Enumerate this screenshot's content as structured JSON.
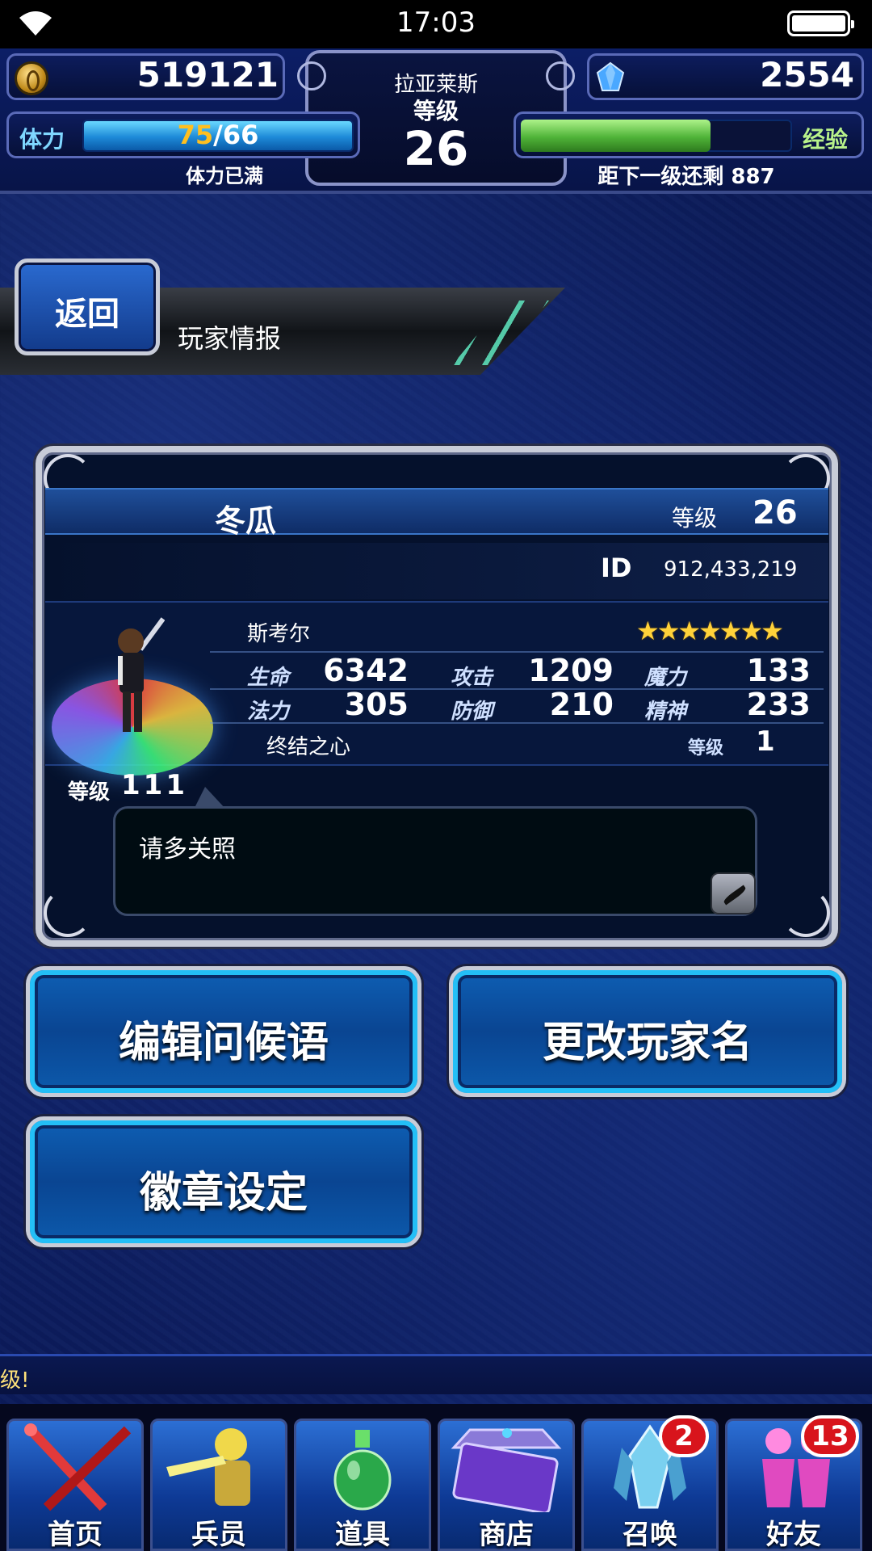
{
  "status_bar": {
    "time": "17:03"
  },
  "hud": {
    "gil": "519121",
    "lapis": "2554",
    "player_name": "拉亚莱斯",
    "level_label": "等级",
    "level": "26",
    "stamina": {
      "label": "体力",
      "current": "75",
      "max": "/66",
      "status": "体力已满"
    },
    "exp": {
      "label": "经验",
      "remaining_text": "距下一级还剩 887",
      "fill_fraction": 0.7
    }
  },
  "header": {
    "back_label": "返回",
    "page_title": "玩家情报"
  },
  "profile": {
    "name": "冬瓜",
    "level_label": "等级",
    "level": "26",
    "id_label": "ID",
    "id_value": "912,433,219",
    "unit": {
      "name": "斯考尔",
      "stars": "★★★★★★★",
      "level_label": "等级",
      "level": "111",
      "stats": [
        {
          "label": "生命",
          "value": "6342"
        },
        {
          "label": "攻击",
          "value": "1209"
        },
        {
          "label": "魔力",
          "value": "133"
        },
        {
          "label": "法力",
          "value": "305"
        },
        {
          "label": "防御",
          "value": "210"
        },
        {
          "label": "精神",
          "value": "233"
        }
      ],
      "equip_name": "终结之心",
      "equip_level_label": "等级",
      "equip_level": "1"
    },
    "greeting": "请多关照"
  },
  "actions": {
    "edit_greeting": "编辑问候语",
    "change_name": "更改玩家名",
    "badge_settings": "徽章设定"
  },
  "ticker": "级!",
  "nav": [
    {
      "label": "首页"
    },
    {
      "label": "兵员"
    },
    {
      "label": "道具"
    },
    {
      "label": "商店"
    },
    {
      "label": "召唤",
      "badge": "2"
    },
    {
      "label": "好友",
      "badge": "13"
    }
  ],
  "colors": {
    "accent": "#23bff7",
    "stamina": "#ffbf1f",
    "exp": "#b8f28a",
    "badge": "#d8141c"
  }
}
